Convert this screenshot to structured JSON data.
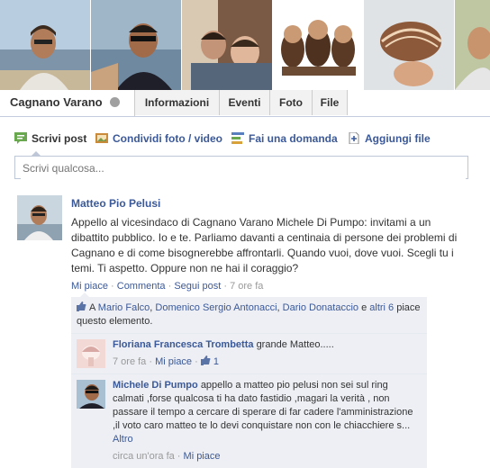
{
  "group": {
    "name": "Cagnano Varano"
  },
  "tabs": [
    "Informazioni",
    "Eventi",
    "Foto",
    "File"
  ],
  "composer": {
    "actions": [
      {
        "label": "Scrivi post",
        "icon": "write-icon"
      },
      {
        "label": "Condividi foto / video",
        "icon": "photo-icon"
      },
      {
        "label": "Fai una domanda",
        "icon": "question-icon"
      },
      {
        "label": "Aggiungi file",
        "icon": "file-icon"
      }
    ],
    "placeholder": "Scrivi qualcosa..."
  },
  "post": {
    "author": "Matteo Pio Pelusi",
    "text": "Appello al vicesindaco di Cagnano Varano Michele Di Pumpo: invitami a un dibattito pubblico. Io e te. Parliamo davanti a centinaia di persone dei problemi di Cagnano e di come bisognerebbe affrontarli. Quando vuoi, dove vuoi. Scegli tu i temi. Ti aspetto. Oppure non ne hai il coraggio?",
    "actions": {
      "like": "Mi piace",
      "comment": "Commenta",
      "follow": "Segui post"
    },
    "time": "7 ore fa"
  },
  "likes": {
    "prefix": "A",
    "people": [
      "Mario Falco",
      "Domenico Sergio Antonacci",
      "Dario Donataccio"
    ],
    "sep1": ",",
    "sep2": ",",
    "and": "e",
    "others": "altri 6",
    "suffix": "piace questo elemento."
  },
  "comments": [
    {
      "author": "Floriana Francesca Trombetta",
      "text": "grande Matteo.....",
      "time": "7 ore fa",
      "like": "Mi piace",
      "like_count": "1"
    },
    {
      "author": "Michele Di Pumpo",
      "text": "appello a matteo pio pelusi non sei sul ring calmati ,forse qualcosa ti ha dato fastidio ,magari la verità , non passare il tempo a cercare di sperare di far cadere l'amministrazione ,il voto caro matteo te lo devi conquistare non con le chiacchiere s...",
      "more": "Altro",
      "time": "circa un'ora fa",
      "like": "Mi piace"
    }
  ]
}
